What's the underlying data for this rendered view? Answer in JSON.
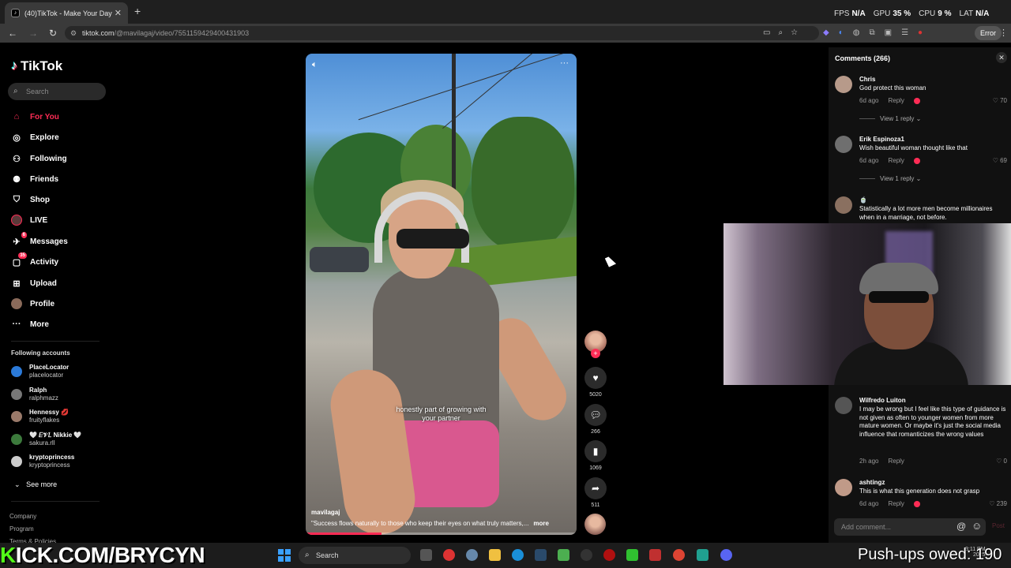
{
  "browser": {
    "tab_title": "(40)TikTok - Make Your Day",
    "tab_favicon": "tiktok-icon",
    "new_tab": "+",
    "url_domain": "tiktok.com",
    "url_path": "/@mavilagaj/video/7551159429400431903",
    "error_label": "Error"
  },
  "overlay_stats": {
    "fps_label": "FPS",
    "fps_value": "N/A",
    "gpu_label": "GPU",
    "gpu_value": "35 %",
    "cpu_label": "CPU",
    "cpu_value": "9 %",
    "lat_label": "LAT",
    "lat_value": "N/A"
  },
  "sidebar": {
    "logo": "TikTok",
    "search_placeholder": "Search",
    "nav": [
      {
        "label": "For You",
        "icon": "home-icon",
        "active": true
      },
      {
        "label": "Explore",
        "icon": "compass-icon"
      },
      {
        "label": "Following",
        "icon": "following-icon"
      },
      {
        "label": "Friends",
        "icon": "friends-icon"
      },
      {
        "label": "Shop",
        "icon": "shop-icon"
      },
      {
        "label": "LIVE",
        "icon": "live-icon"
      },
      {
        "label": "Messages",
        "icon": "messages-icon",
        "badge": "6"
      },
      {
        "label": "Activity",
        "icon": "activity-icon",
        "badge": "35"
      },
      {
        "label": "Upload",
        "icon": "upload-icon"
      },
      {
        "label": "Profile",
        "icon": "profile-icon"
      },
      {
        "label": "More",
        "icon": "more-icon"
      }
    ],
    "following_title": "Following accounts",
    "accounts": [
      {
        "name": "PlaceLocator",
        "username": "placelocator"
      },
      {
        "name": "Ralph",
        "username": "ralphmazz"
      },
      {
        "name": "Hennessy 💋",
        "username": "fruityflakes"
      },
      {
        "name": "🤍 𝐸𝒱𝐿 Nikkie 🤍",
        "username": "sakura.rll"
      },
      {
        "name": "kryptoprincess",
        "username": "kryptoprincess"
      }
    ],
    "see_all": "See more",
    "footer": [
      "Company",
      "Program",
      "Terms & Policies"
    ]
  },
  "video": {
    "caption": "honestly part of growing with\nyour partner",
    "username": "mavilagaj",
    "description": "\"Success flows naturally to those who keep their eyes on what truly matters,...",
    "more": "more",
    "progress": 0.28
  },
  "actions": {
    "likes": "5020",
    "comments": "266",
    "saves": "1069",
    "shares": "511"
  },
  "comments": {
    "title": "Comments (266)",
    "add_placeholder": "Add comment...",
    "post": "Post",
    "items": [
      {
        "user": "Chris",
        "text": "God protect this woman",
        "age": "6d ago",
        "reply": "Reply",
        "likes": "70",
        "view_replies": "View 1 reply ⌄"
      },
      {
        "user": "Erik Espinoza1",
        "text": "Wish beautiful woman thought like that",
        "age": "6d ago",
        "reply": "Reply",
        "likes": "69",
        "view_replies": "View 1 reply ⌄"
      },
      {
        "user": "🍵",
        "text": "Statistically a lot more men become millionaires when in a marriage, not before."
      },
      {
        "user": "Wilfredo Luiton",
        "text": "I may be wrong but I feel like this type of guidance is not given as often to younger women from more mature women. Or maybe it's just the social media influence that romanticizes the wrong values",
        "age": "2h ago",
        "reply": "Reply",
        "likes": "0"
      },
      {
        "user": "ashtingz",
        "text": "This is what this generation does not grasp",
        "age": "6d ago",
        "reply": "Reply",
        "likes": "239"
      }
    ]
  },
  "stream": {
    "kick_k": "K",
    "kick_rest": "ICK.COM/BRYCYN",
    "pushups": "Push-ups owed: 190",
    "taskbar_search": "Search",
    "clock_time": "3:11 PM",
    "clock_date": "2025"
  },
  "colors": {
    "tiktok_red": "#fe2c55",
    "kick_green": "#53fc18"
  }
}
